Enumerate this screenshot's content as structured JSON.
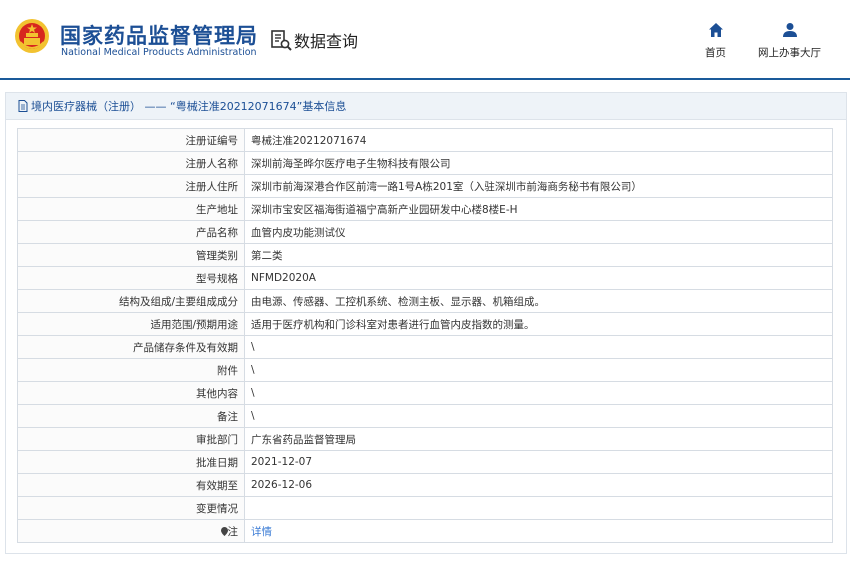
{
  "header": {
    "brand_cn": "国家药品监督管理局",
    "brand_en": "National Medical Products Administration",
    "query_label": "数据查询",
    "nav": [
      {
        "label": "首页",
        "icon": "home-icon"
      },
      {
        "label": "网上办事大厅",
        "icon": "user-icon"
      }
    ]
  },
  "panel": {
    "title": "境内医疗器械（注册） —— “粤械注准20212071674”基本信息"
  },
  "rows": [
    {
      "key": "注册证编号",
      "value": "粤械注准20212071674"
    },
    {
      "key": "注册人名称",
      "value": "深圳前海圣晔尔医疗电子生物科技有限公司"
    },
    {
      "key": "注册人住所",
      "value": "深圳市前海深港合作区前湾一路1号A栋201室（入驻深圳市前海商务秘书有限公司）"
    },
    {
      "key": "生产地址",
      "value": "深圳市宝安区福海街道福宁高新产业园研发中心楼8楼E-H"
    },
    {
      "key": "产品名称",
      "value": "血管内皮功能测试仪"
    },
    {
      "key": "管理类别",
      "value": "第二类"
    },
    {
      "key": "型号规格",
      "value": "NFMD2020A"
    },
    {
      "key": "结构及组成/主要组成成分",
      "value": "由电源、传感器、工控机系统、检测主板、显示器、机箱组成。"
    },
    {
      "key": "适用范围/预期用途",
      "value": "适用于医疗机构和门诊科室对患者进行血管内皮指数的测量。"
    },
    {
      "key": "产品储存条件及有效期",
      "value": "\\"
    },
    {
      "key": "附件",
      "value": "\\"
    },
    {
      "key": "其他内容",
      "value": "\\"
    },
    {
      "key": "备注",
      "value": "\\"
    },
    {
      "key": "审批部门",
      "value": "广东省药品监督管理局"
    },
    {
      "key": "批准日期",
      "value": "2021-12-07"
    },
    {
      "key": "有效期至",
      "value": "2026-12-06"
    },
    {
      "key": "变更情况",
      "value": ""
    },
    {
      "key": "注",
      "value": "详情",
      "link": true
    }
  ],
  "colors": {
    "brand": "#1c4f95",
    "link": "#3a7bd5",
    "emblem_red": "#d7261e",
    "emblem_gold": "#f2c230"
  }
}
